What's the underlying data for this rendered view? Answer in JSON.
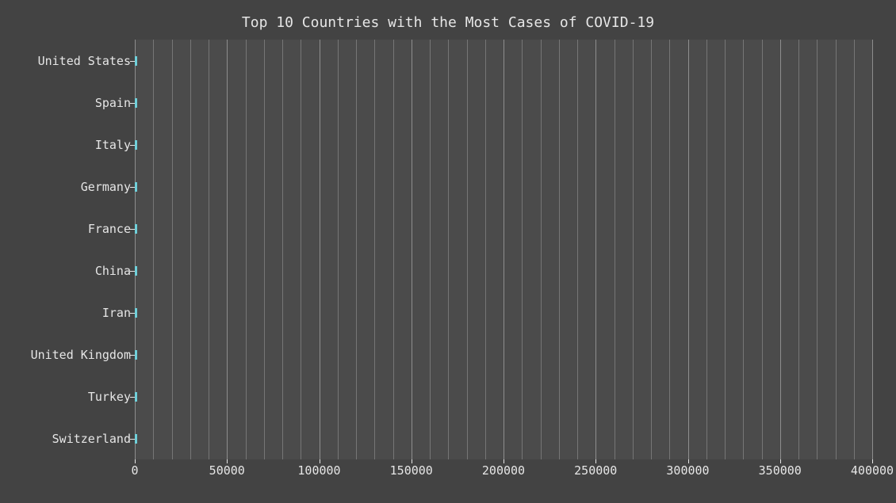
{
  "chart_data": {
    "type": "bar",
    "orientation": "horizontal",
    "title": "Top 10 Countries with the Most Cases of COVID-19",
    "categories": [
      "United States",
      "Spain",
      "Italy",
      "Germany",
      "France",
      "China",
      "Iran",
      "United Kingdom",
      "Turkey",
      "Switzerland"
    ],
    "values": [
      1500,
      1500,
      1500,
      1500,
      1500,
      1500,
      1500,
      1500,
      1500,
      1500
    ],
    "xlabel": "",
    "ylabel": "",
    "xlim": [
      0,
      400000
    ],
    "xticks": [
      0,
      50000,
      100000,
      150000,
      200000,
      250000,
      300000,
      350000,
      400000
    ],
    "xtick_labels": [
      "0",
      "50000",
      "100000",
      "150000",
      "200000",
      "250000",
      "300000",
      "350000",
      "400000"
    ],
    "bar_color": "#6fd0da",
    "grid": true
  }
}
